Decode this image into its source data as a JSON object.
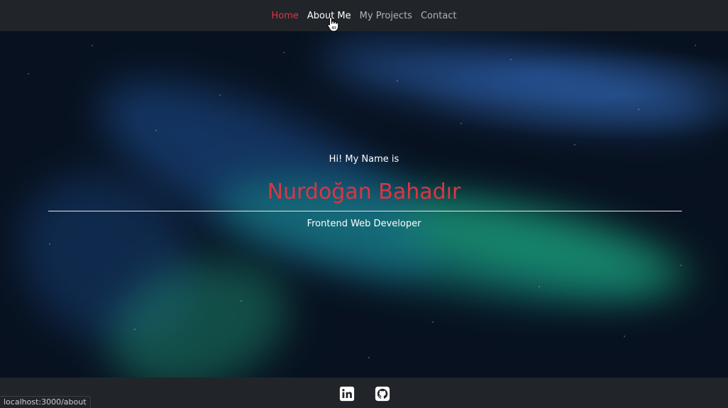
{
  "nav": {
    "items": [
      {
        "label": "Home",
        "state": "active"
      },
      {
        "label": "About Me",
        "state": "hover"
      },
      {
        "label": "My Projects",
        "state": "normal"
      },
      {
        "label": "Contact",
        "state": "normal"
      }
    ]
  },
  "hero": {
    "greeting": "Hi! My Name is",
    "name": "Nurdoğan Bahadır",
    "role": "Frontend Web Developer"
  },
  "footer": {
    "social": [
      {
        "icon": "linkedin-icon"
      },
      {
        "icon": "github-icon"
      }
    ]
  },
  "status_bar": {
    "url": "localhost:3000/about"
  },
  "colors": {
    "accent": "#dc3545",
    "navbar_bg": "#212529",
    "text": "#ffffff",
    "nav_text": "#b0b3b8"
  }
}
